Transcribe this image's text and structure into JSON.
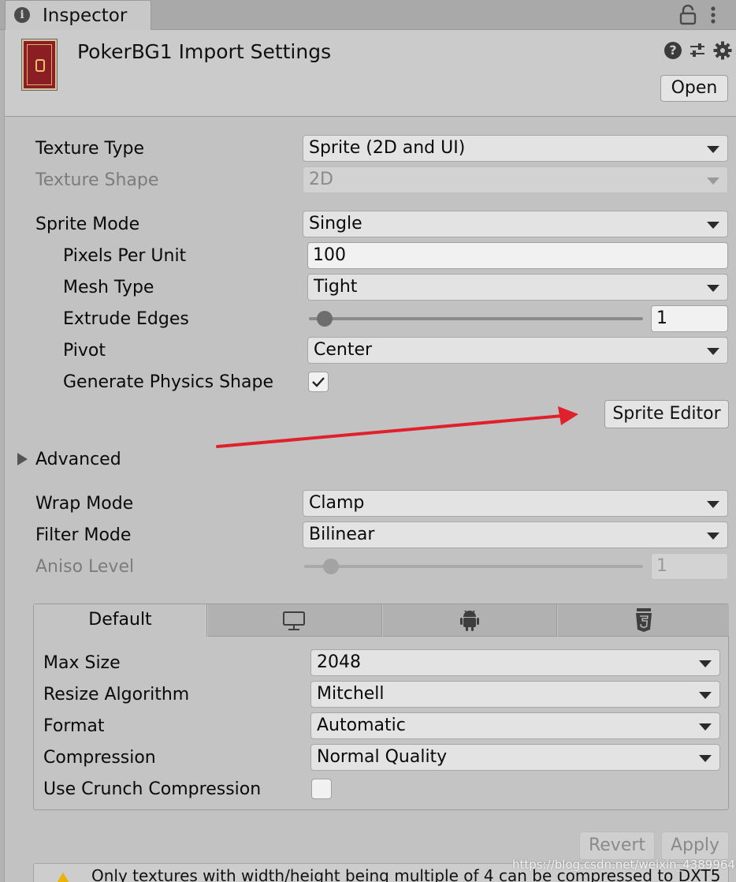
{
  "window": {
    "tab_label": "Inspector"
  },
  "header": {
    "title": "PokerBG1 Import Settings",
    "open_label": "Open"
  },
  "fields": {
    "texture_type": {
      "label": "Texture Type",
      "value": "Sprite (2D and UI)"
    },
    "texture_shape": {
      "label": "Texture Shape",
      "value": "2D"
    },
    "sprite_mode": {
      "label": "Sprite Mode",
      "value": "Single"
    },
    "pixels_per_unit": {
      "label": "Pixels Per Unit",
      "value": "100"
    },
    "mesh_type": {
      "label": "Mesh Type",
      "value": "Tight"
    },
    "extrude_edges": {
      "label": "Extrude Edges",
      "value": "1"
    },
    "pivot": {
      "label": "Pivot",
      "value": "Center"
    },
    "generate_physics_shape": {
      "label": "Generate Physics Shape",
      "checked": true
    },
    "sprite_editor_label": "Sprite Editor",
    "advanced_label": "Advanced",
    "wrap_mode": {
      "label": "Wrap Mode",
      "value": "Clamp"
    },
    "filter_mode": {
      "label": "Filter Mode",
      "value": "Bilinear"
    },
    "aniso_level": {
      "label": "Aniso Level",
      "value": "1"
    }
  },
  "platform": {
    "default_tab": "Default",
    "tab_icons": [
      "monitor-icon",
      "android-icon",
      "html5-icon"
    ],
    "max_size": {
      "label": "Max Size",
      "value": "2048"
    },
    "resize_algorithm": {
      "label": "Resize Algorithm",
      "value": "Mitchell"
    },
    "format": {
      "label": "Format",
      "value": "Automatic"
    },
    "compression": {
      "label": "Compression",
      "value": "Normal Quality"
    },
    "use_crunch": {
      "label": "Use Crunch Compression",
      "checked": false
    }
  },
  "footer": {
    "revert_label": "Revert",
    "apply_label": "Apply",
    "warning": "Only textures with width/height being multiple of 4 can be compressed to DXT5",
    "watermark": "https://blog.csdn.net/weixin_43899645"
  },
  "colors": {
    "annotation_arrow": "#e0202a",
    "warning": "#e8b400"
  }
}
